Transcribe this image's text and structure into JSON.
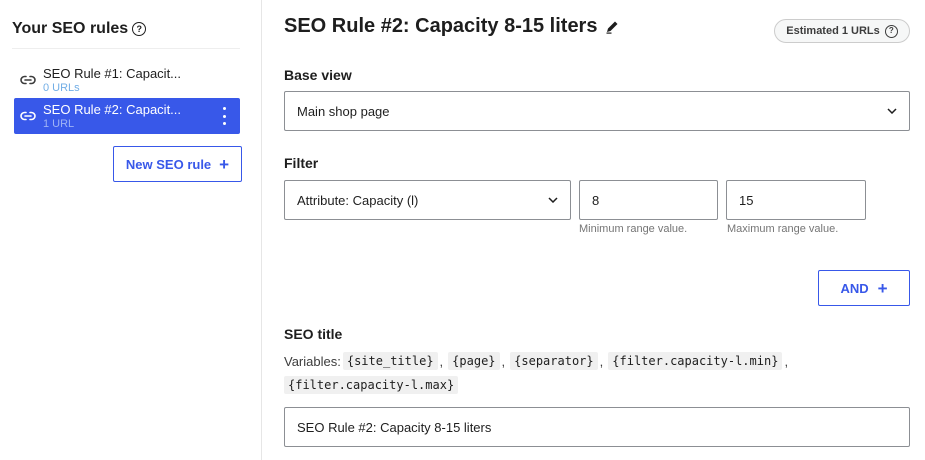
{
  "sidebar": {
    "title": "Your SEO rules",
    "help_glyph": "?",
    "rules": [
      {
        "name": "SEO Rule #1: Capacit...",
        "count": "0 URLs",
        "active": false
      },
      {
        "name": "SEO Rule #2: Capacit...",
        "count": "1 URL",
        "active": true
      }
    ],
    "new_rule_label": "New SEO rule",
    "new_rule_glyph": "+"
  },
  "main": {
    "title": "SEO Rule #2: Capacity 8-15 liters",
    "estimated_badge": "Estimated 1 URLs",
    "base_view": {
      "label": "Base view",
      "selected": "Main shop page"
    },
    "filter": {
      "label": "Filter",
      "attribute_selected": "Attribute: Capacity (l)",
      "min_value": "8",
      "max_value": "15",
      "min_hint": "Minimum range value.",
      "max_hint": "Maximum range value.",
      "and_label": "AND"
    },
    "seo_title": {
      "label": "SEO title",
      "variables_prefix": "Variables:",
      "variables": [
        "{site_title}",
        "{page}",
        "{separator}",
        "{filter.capacity-l.min}",
        "{filter.capacity-l.max}"
      ],
      "value": "SEO Rule #2: Capacity 8-15 liters"
    }
  },
  "colors": {
    "accent": "#3858e9",
    "count_link": "#72aee6"
  },
  "icons": {
    "rule": "link-icon",
    "edit": "pencil-icon",
    "help": "help-circle-icon",
    "dropdown": "chevron-down-icon",
    "menu": "more-vertical-icon"
  }
}
